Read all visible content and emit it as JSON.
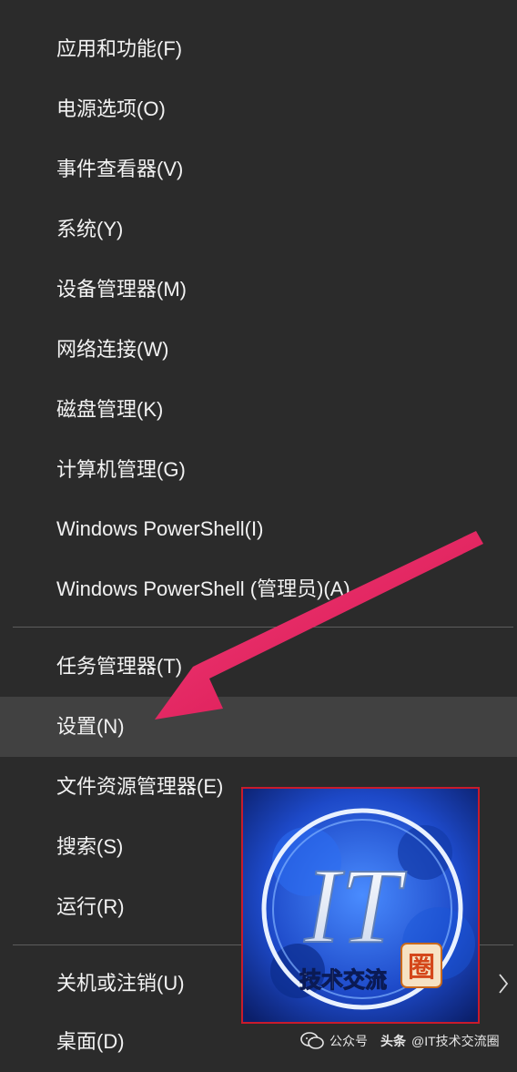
{
  "menu": {
    "items": [
      {
        "label": "应用和功能(F)"
      },
      {
        "label": "电源选项(O)"
      },
      {
        "label": "事件查看器(V)"
      },
      {
        "label": "系统(Y)"
      },
      {
        "label": "设备管理器(M)"
      },
      {
        "label": "网络连接(W)"
      },
      {
        "label": "磁盘管理(K)"
      },
      {
        "label": "计算机管理(G)"
      },
      {
        "label": "Windows PowerShell(I)"
      },
      {
        "label": "Windows PowerShell (管理员)(A)"
      },
      {
        "label": "任务管理器(T)"
      },
      {
        "label": "设置(N)",
        "highlighted": true
      },
      {
        "label": "文件资源管理器(E)"
      },
      {
        "label": "搜索(S)"
      },
      {
        "label": "运行(R)"
      },
      {
        "label": "关机或注销(U)",
        "has_submenu": true,
        "submenu_icon": "chevron-right-icon"
      },
      {
        "label": "桌面(D)"
      }
    ]
  },
  "overlay": {
    "arrow_icon": "pointer-arrow-icon",
    "arrow_color": "#e8195a",
    "logo": {
      "text_big": "IT",
      "text_small": "技术交流",
      "seal": "圈",
      "border_color": "#c81b2c"
    }
  },
  "watermark": {
    "icon": "wechat-official-account-icon",
    "official_label": "公众号",
    "platform": "头条",
    "account": "@IT技术交流圈"
  },
  "colors": {
    "menu_bg": "#2b2b2b",
    "highlight_bg": "#414141",
    "text": "#f2f2f2",
    "separator": "#5d5d5d"
  }
}
